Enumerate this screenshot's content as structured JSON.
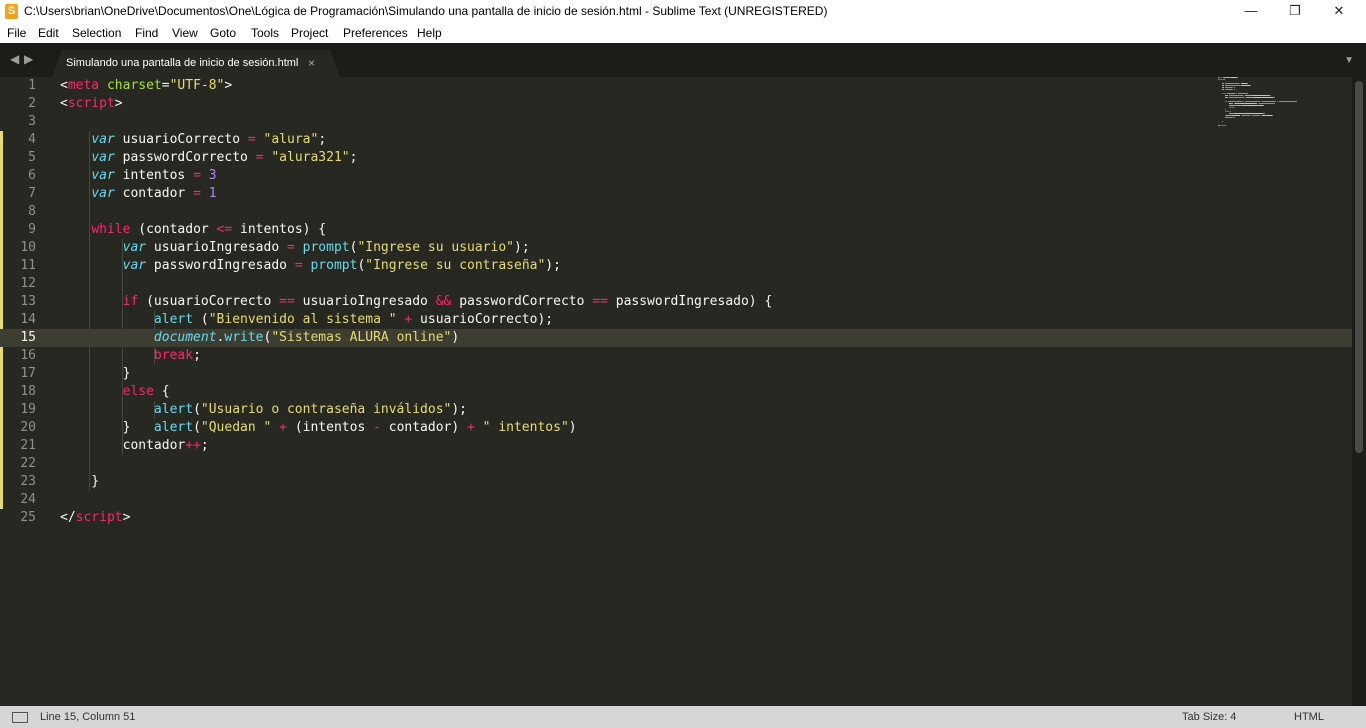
{
  "window": {
    "title": "C:\\Users\\brian\\OneDrive\\Documentos\\One\\Lógica de Programación\\Simulando una pantalla de inicio de sesión.html - Sublime Text (UNREGISTERED)",
    "minimize": "—",
    "maximize": "❐",
    "close": "✕"
  },
  "menu": [
    "File",
    "Edit",
    "Selection",
    "Find",
    "View",
    "Goto",
    "Tools",
    "Project",
    "Preferences",
    "Help"
  ],
  "tabs": [
    {
      "label": "Simulando una pantalla de inicio de sesión.html",
      "close": "×"
    }
  ],
  "tab_nav": {
    "prev": "◀",
    "next": "▶",
    "dropdown": "▼"
  },
  "editor": {
    "current_line": 15,
    "lines": [
      [
        [
          "tag",
          "<"
        ],
        [
          "tk-tag",
          "meta"
        ],
        [
          "tk-punc",
          " "
        ],
        [
          "tk-attr",
          "charset"
        ],
        [
          "tk-punc",
          "="
        ],
        [
          "tk-str",
          "\"UTF-8\""
        ],
        [
          "tk-punc",
          ">"
        ]
      ],
      [
        [
          "tk-punc",
          "<"
        ],
        [
          "tk-tag",
          "script"
        ],
        [
          "tk-punc",
          ">"
        ]
      ],
      [],
      [
        [
          "tk-punc",
          "    "
        ],
        [
          "tk-kw",
          "var"
        ],
        [
          "tk-punc",
          " usuarioCorrecto "
        ],
        [
          "tk-op",
          "="
        ],
        [
          "tk-punc",
          " "
        ],
        [
          "tk-str",
          "\"alura\""
        ],
        [
          "tk-punc",
          ";"
        ]
      ],
      [
        [
          "tk-punc",
          "    "
        ],
        [
          "tk-kw",
          "var"
        ],
        [
          "tk-punc",
          " passwordCorrecto "
        ],
        [
          "tk-op",
          "="
        ],
        [
          "tk-punc",
          " "
        ],
        [
          "tk-str",
          "\"alura321\""
        ],
        [
          "tk-punc",
          ";"
        ]
      ],
      [
        [
          "tk-punc",
          "    "
        ],
        [
          "tk-kw",
          "var"
        ],
        [
          "tk-punc",
          " intentos "
        ],
        [
          "tk-op",
          "="
        ],
        [
          "tk-punc",
          " "
        ],
        [
          "tk-num",
          "3"
        ]
      ],
      [
        [
          "tk-punc",
          "    "
        ],
        [
          "tk-kw",
          "var"
        ],
        [
          "tk-punc",
          " contador "
        ],
        [
          "tk-op",
          "="
        ],
        [
          "tk-punc",
          " "
        ],
        [
          "tk-num",
          "1"
        ]
      ],
      [],
      [
        [
          "tk-punc",
          "    "
        ],
        [
          "tk-kw2",
          "while"
        ],
        [
          "tk-punc",
          " (contador "
        ],
        [
          "tk-op",
          "<="
        ],
        [
          "tk-punc",
          " intentos) {"
        ]
      ],
      [
        [
          "tk-punc",
          "        "
        ],
        [
          "tk-kw",
          "var"
        ],
        [
          "tk-punc",
          " usuarioIngresado "
        ],
        [
          "tk-op",
          "="
        ],
        [
          "tk-punc",
          " "
        ],
        [
          "tk-fn",
          "prompt"
        ],
        [
          "tk-punc",
          "("
        ],
        [
          "tk-str",
          "\"Ingrese su usuario\""
        ],
        [
          "tk-punc",
          ");"
        ]
      ],
      [
        [
          "tk-punc",
          "        "
        ],
        [
          "tk-kw",
          "var"
        ],
        [
          "tk-punc",
          " passwordIngresado "
        ],
        [
          "tk-op",
          "="
        ],
        [
          "tk-punc",
          " "
        ],
        [
          "tk-fn",
          "prompt"
        ],
        [
          "tk-punc",
          "("
        ],
        [
          "tk-str",
          "\"Ingrese su contraseña\""
        ],
        [
          "tk-punc",
          ");"
        ]
      ],
      [],
      [
        [
          "tk-punc",
          "        "
        ],
        [
          "tk-kw2",
          "if"
        ],
        [
          "tk-punc",
          " (usuarioCorrecto "
        ],
        [
          "tk-op",
          "=="
        ],
        [
          "tk-punc",
          " usuarioIngresado "
        ],
        [
          "tk-op",
          "&&"
        ],
        [
          "tk-punc",
          " passwordCorrecto "
        ],
        [
          "tk-op",
          "=="
        ],
        [
          "tk-punc",
          " passwordIngresado) {"
        ]
      ],
      [
        [
          "tk-punc",
          "            "
        ],
        [
          "tk-fn",
          "alert"
        ],
        [
          "tk-punc",
          " ("
        ],
        [
          "tk-str",
          "\"Bienvenido al sistema \""
        ],
        [
          "tk-punc",
          " "
        ],
        [
          "tk-op",
          "+"
        ],
        [
          "tk-punc",
          " usuarioCorrecto);"
        ]
      ],
      [
        [
          "tk-punc",
          "            "
        ],
        [
          "tk-obj",
          "document"
        ],
        [
          "tk-punc",
          "."
        ],
        [
          "tk-fn",
          "write"
        ],
        [
          "tk-punc",
          "("
        ],
        [
          "tk-str",
          "\"Sistemas ALURA online\""
        ],
        [
          "tk-punc",
          ")"
        ]
      ],
      [
        [
          "tk-punc",
          "            "
        ],
        [
          "tk-kw2",
          "break"
        ],
        [
          "tk-punc",
          ";"
        ]
      ],
      [
        [
          "tk-punc",
          "        }"
        ]
      ],
      [
        [
          "tk-punc",
          "        "
        ],
        [
          "tk-kw2",
          "else"
        ],
        [
          "tk-punc",
          " {"
        ]
      ],
      [
        [
          "tk-punc",
          "            "
        ],
        [
          "tk-fn",
          "alert"
        ],
        [
          "tk-punc",
          "("
        ],
        [
          "tk-str",
          "\"Usuario o contraseña inválidos\""
        ],
        [
          "tk-punc",
          ");"
        ]
      ],
      [
        [
          "tk-punc",
          "        }   "
        ],
        [
          "tk-fn",
          "alert"
        ],
        [
          "tk-punc",
          "("
        ],
        [
          "tk-str",
          "\"Quedan \""
        ],
        [
          "tk-punc",
          " "
        ],
        [
          "tk-op",
          "+"
        ],
        [
          "tk-punc",
          " (intentos "
        ],
        [
          "tk-op",
          "-"
        ],
        [
          "tk-punc",
          " contador) "
        ],
        [
          "tk-op",
          "+"
        ],
        [
          "tk-punc",
          " "
        ],
        [
          "tk-str",
          "\" intentos\""
        ],
        [
          "tk-punc",
          ")"
        ]
      ],
      [
        [
          "tk-punc",
          "        contador"
        ],
        [
          "tk-op",
          "++"
        ],
        [
          "tk-punc",
          ";"
        ]
      ],
      [],
      [
        [
          "tk-punc",
          "    }"
        ]
      ],
      [],
      [
        [
          "tk-punc",
          "</"
        ],
        [
          "tk-tag",
          "script"
        ],
        [
          "tk-punc",
          ">"
        ]
      ]
    ]
  },
  "status": {
    "position": "Line 15, Column 51",
    "tab_size": "Tab Size: 4",
    "syntax": "HTML"
  }
}
